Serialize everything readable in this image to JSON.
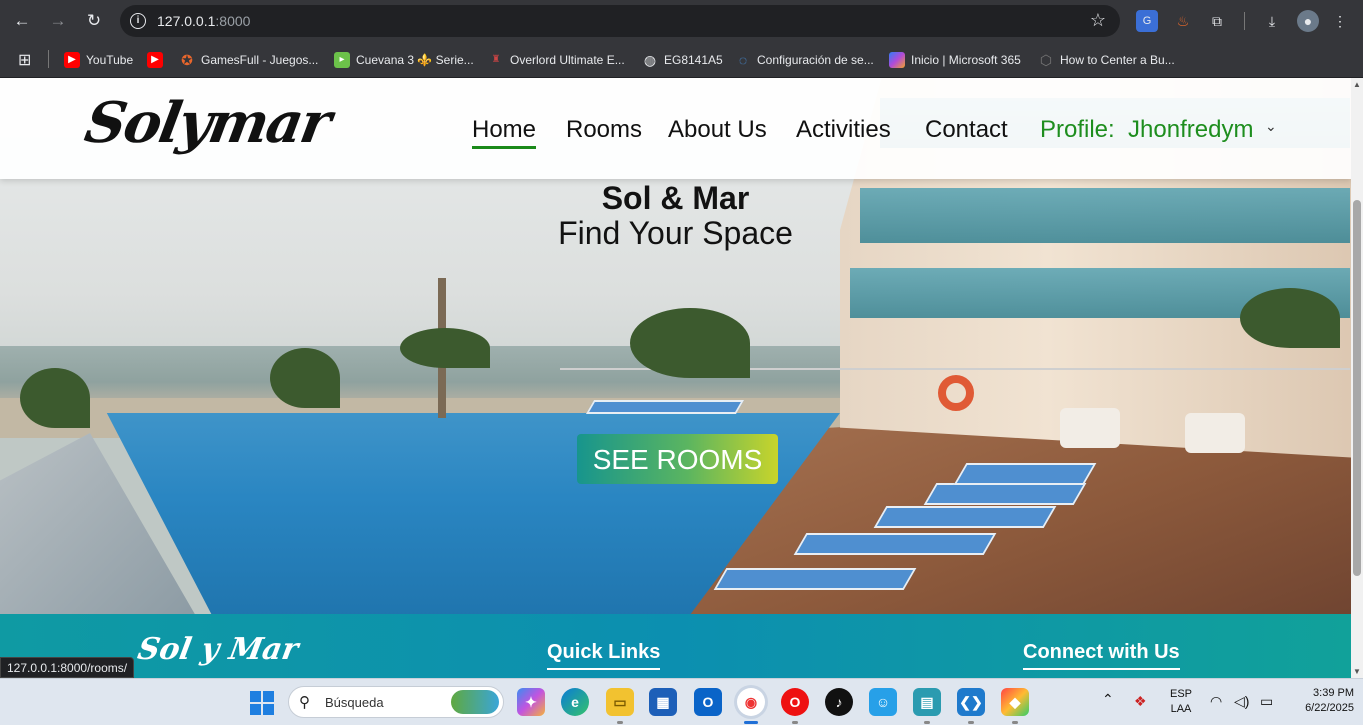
{
  "browser": {
    "url_host": "127.0.0.1",
    "url_port": ":8000",
    "bookmarks": [
      {
        "label": "YouTube",
        "icon": "youtube-icon",
        "color": "#ff0000"
      },
      {
        "label": "",
        "icon": "youtube-icon",
        "color": "#ff0000"
      },
      {
        "label": "GamesFull - Juegos...",
        "icon": "gamepad-icon",
        "color": "#e8662c"
      },
      {
        "label": "Cuevana 3 ⚜️ Serie...",
        "icon": "play-icon",
        "color": "#6cc24a"
      },
      {
        "label": "Overlord Ultimate E...",
        "icon": "figure-icon",
        "color": "#b33"
      },
      {
        "label": "EG8141A5",
        "icon": "globe-icon",
        "color": "#e8eaed"
      },
      {
        "label": "Configuración de se...",
        "icon": "loading-icon",
        "color": "#4aa3ff"
      },
      {
        "label": "Inicio | Microsoft 365",
        "icon": "microsoft365-icon",
        "color": "#7b5cff"
      },
      {
        "label": "How to Center a Bu...",
        "icon": "hexagon-icon",
        "color": "#555"
      }
    ],
    "status_url": "127.0.0.1:8000/rooms/"
  },
  "site": {
    "logo": "Solymar",
    "nav": {
      "home": "Home",
      "rooms": "Rooms",
      "about": "About Us",
      "activities": "Activities",
      "contact": "Contact",
      "profile_label": "Profile:",
      "profile_user": "Jhonfredym"
    },
    "hero": {
      "title": "Sol & Mar",
      "subtitle": "Find Your Space",
      "cta": "SEE ROOMS"
    },
    "footer": {
      "logo": "Sol y Mar",
      "quick_links": "Quick Links",
      "connect": "Connect with Us"
    },
    "colors": {
      "accent_green": "#1e8e1e",
      "footer_teal": "#0f9aa3"
    }
  },
  "taskbar": {
    "search_placeholder": "Búsqueda",
    "lang_top": "ESP",
    "lang_bottom": "LAA",
    "time": "3:39 PM",
    "date": "6/22/2025"
  }
}
